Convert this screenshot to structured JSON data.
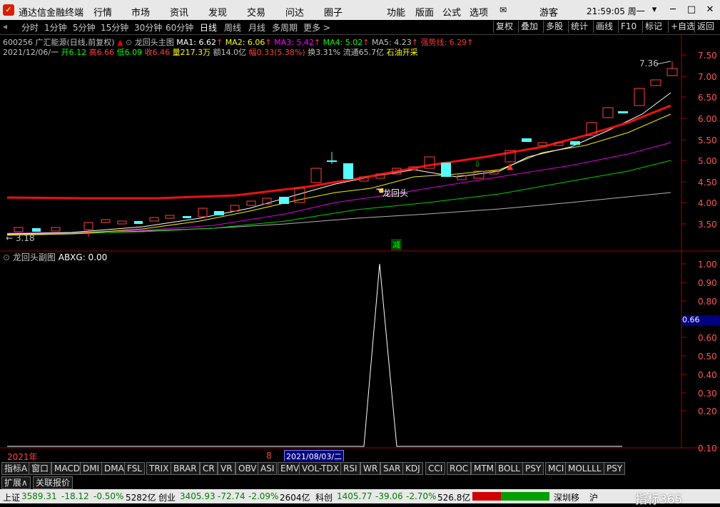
{
  "titlebar": {
    "app_title": "通达信金融终端",
    "menus": [
      "行情",
      "市场",
      "资讯",
      "发现",
      "交易",
      "问达",
      "圈子"
    ],
    "right_menus": [
      "功能",
      "版面",
      "公式",
      "选项"
    ],
    "user": "游客",
    "clock": "21:59:05 周一"
  },
  "toolbar": {
    "periods": [
      "分时",
      "1分钟",
      "5分钟",
      "15分钟",
      "30分钟",
      "60分钟",
      "日线",
      "周线",
      "月线",
      "多周期",
      "更多 >"
    ],
    "active_period": "日线",
    "right_buttons": [
      "复权",
      "叠加",
      "多股",
      "统计",
      "画线",
      "F10",
      "标记",
      "+自选",
      "返回"
    ]
  },
  "header": {
    "stock": "600256 广汇能源(日线,前复权)",
    "indicator_name": "龙回头主图",
    "ma": [
      {
        "label": "MA1: 6.62",
        "color": "#ffffff"
      },
      {
        "label": "MA2: 6.06",
        "color": "#ffff00"
      },
      {
        "label": "MA3: 5.42",
        "color": "#ff00ff"
      },
      {
        "label": "MA4: 5.02",
        "color": "#00ff00"
      },
      {
        "label": "MA5: 4.23",
        "color": "#c0c0c0"
      }
    ],
    "strong_line": "强势线: 6.29",
    "date": "2021/12/06/一",
    "open": "开6.12",
    "high": "高6.66",
    "low": "低6.09",
    "close": "收6.46",
    "volume": "量217.3万",
    "amount": "额14.0亿",
    "change": "幅0.33(5.38%)",
    "turnover": "换3.31%",
    "float_cap": "流通65.7亿",
    "sector": "石油开采"
  },
  "main_chart": {
    "y_ticks": [
      "7.50",
      "7.00",
      "6.50",
      "6.00",
      "5.50",
      "5.00",
      "4.50",
      "4.00",
      "3.50"
    ],
    "high_label": "7.36",
    "low_label": "3.18",
    "annotation": "龙回头",
    "bottom_marker": "减"
  },
  "sub_chart": {
    "title": "龙回头副图",
    "value_label": "ABXG: 0.00",
    "y_ticks": [
      "1.00",
      "0.90",
      "0.80",
      "0.70",
      "0.60",
      "0.50",
      "0.40",
      "0.30",
      "0.20",
      "0.10"
    ],
    "current_value": "0.66"
  },
  "timeline": {
    "year": "2021年",
    "month": "8",
    "cursor_date": "2021/08/03/二"
  },
  "tabs": {
    "first": [
      "指标A",
      "窗口"
    ],
    "items": [
      "MACD",
      "DMI",
      "DMA",
      "FSL",
      "TRIX",
      "BRAR",
      "CR",
      "VR",
      "OBV",
      "ASI",
      "EMV",
      "VOL-TDX",
      "RSI",
      "WR",
      "SAR",
      "KDJ",
      "CCI",
      "ROC",
      "MTM",
      "BOLL",
      "PSY",
      "MCI",
      "MOLLLL",
      "PSY"
    ],
    "second_row": [
      "扩展∧",
      "关联报价"
    ]
  },
  "status": {
    "sh_name": "上证",
    "sh_val": "3589.31",
    "sh_chg": "-18.12",
    "sh_pct": "-0.50%",
    "sh_amt": "5282亿",
    "cy_name": "创业",
    "cy_val": "3405.93",
    "cy_chg": "-72.74",
    "cy_pct": "-2.09%",
    "cy_amt": "2604亿",
    "kc_name": "科创",
    "kc_val": "1405.77",
    "kc_chg": "-39.06",
    "kc_pct": "-2.70%",
    "kc_amt": "526.8亿",
    "right1": "深圳移",
    "right2": "沪",
    "brand": "指标365"
  }
}
